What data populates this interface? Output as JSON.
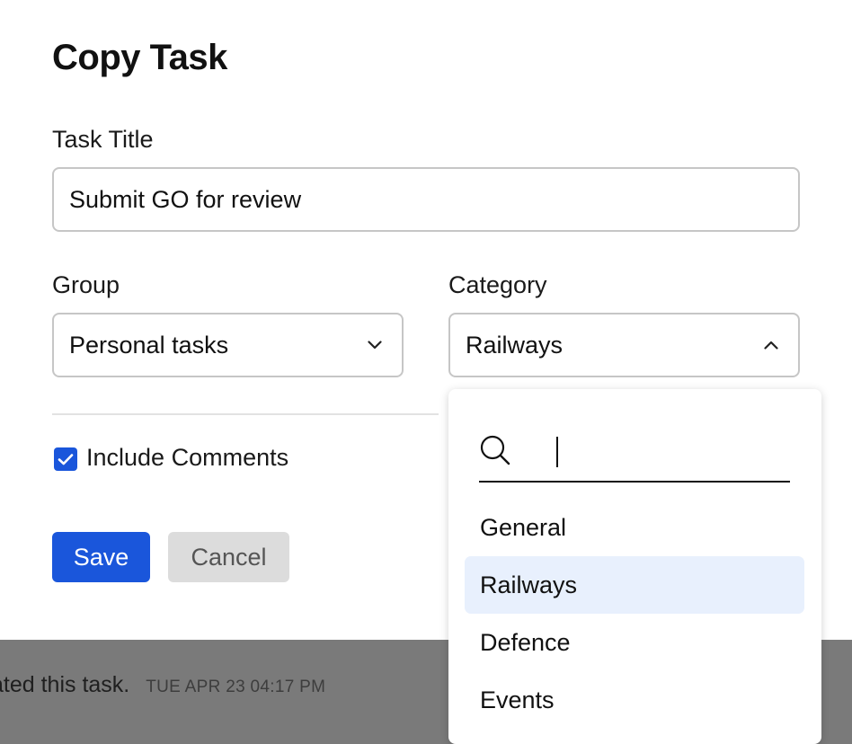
{
  "background": {
    "activity_text": "ated this task.",
    "activity_time": "TUE APR 23 04:17 PM"
  },
  "modal": {
    "title": "Copy Task",
    "task_title": {
      "label": "Task Title",
      "value": "Submit GO for review"
    },
    "group": {
      "label": "Group",
      "value": "Personal tasks",
      "icon": "chevron-down-icon"
    },
    "category": {
      "label": "Category",
      "value": "Railways",
      "icon": "chevron-up-icon"
    },
    "include_comments": {
      "label": "Include Comments",
      "checked": true
    },
    "save_label": "Save",
    "cancel_label": "Cancel"
  },
  "category_dropdown": {
    "search_value": "",
    "search_icon": "search-icon",
    "items": [
      {
        "label": "General"
      },
      {
        "label": "Railways",
        "selected": true
      },
      {
        "label": "Defence"
      },
      {
        "label": "Events"
      }
    ]
  },
  "colors": {
    "accent": "#1a56db",
    "selected_item_bg": "#e8f0fd",
    "overlay": "#7a7a7a"
  }
}
